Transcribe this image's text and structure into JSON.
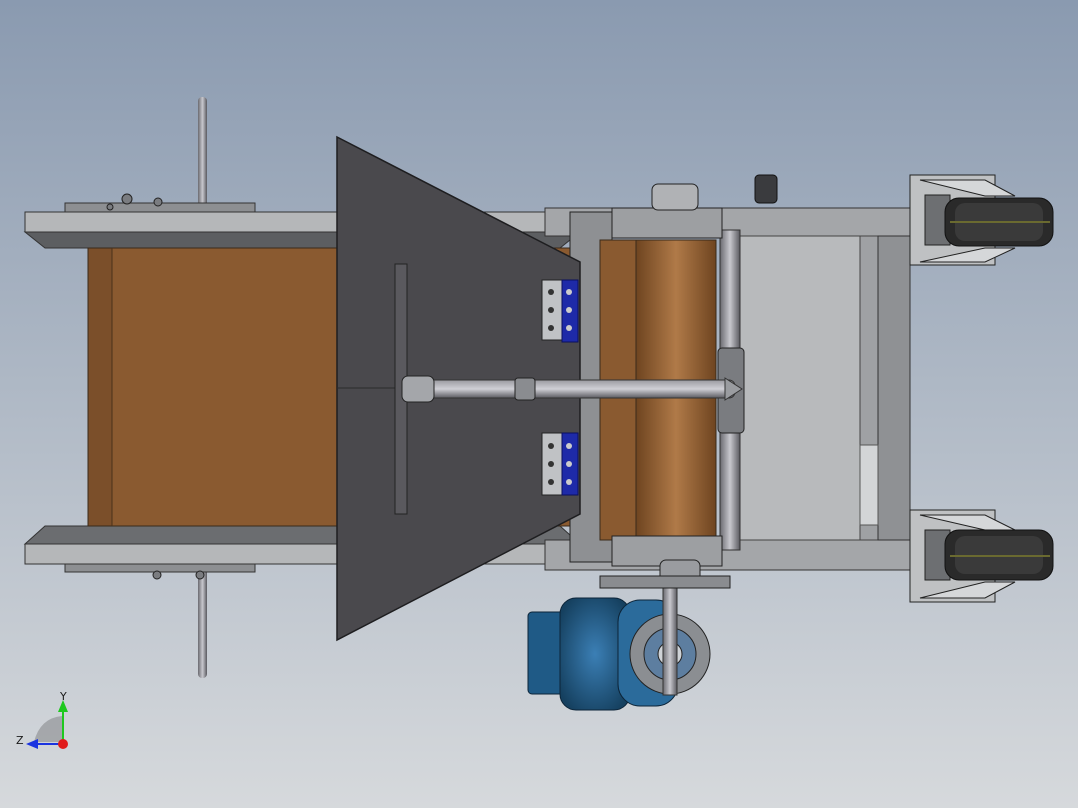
{
  "viewport": {
    "background_top": "#8a9ab0",
    "background_bottom": "#d6d9dc"
  },
  "colors": {
    "frame_steel": "#a9abad",
    "frame_dark": "#6b6d70",
    "belt_wood": "#8a5a30",
    "belt_wood_light": "#a06a3a",
    "hopper_plate": "#4a494d",
    "motor_blue": "#1f5a86",
    "hinge_blue": "#1e2aa8",
    "wheel_tire": "#2a2a2a",
    "axis_x": "#e01b1b",
    "axis_y": "#1ec81e",
    "axis_z": "#1b34e0"
  },
  "triad": {
    "y_label": "Y",
    "z_label": "Z"
  }
}
